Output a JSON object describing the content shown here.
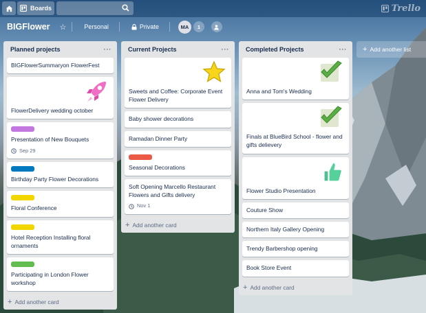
{
  "nav": {
    "boards_label": "Boards",
    "search_placeholder": "",
    "logo_text": "Trello"
  },
  "board": {
    "title": "BIGFlower",
    "visibility_team": "Personal",
    "visibility_privacy": "Private",
    "member_initials": "MA",
    "member_count": "1",
    "add_list_label": "Add another list"
  },
  "lists": [
    {
      "title": "Planned projects",
      "menu": "···",
      "add_card": "Add another card",
      "cards": [
        {
          "text": "BIGFlowerSummaryon FlowerFest"
        },
        {
          "text": "FlowerDelivery wedding october",
          "sticker": "rocket-sticker"
        },
        {
          "text": "Presentation of New Bouquets",
          "label_color": "#c377e0",
          "due": "Sep 29"
        },
        {
          "text": "Birthday Party Flower Decorations",
          "label_color": "#0079bf"
        },
        {
          "text": "Floral Conference",
          "label_color": "#f2d600"
        },
        {
          "text": "Hotel Reception Installing floral ornaments",
          "label_color": "#f2d600"
        },
        {
          "text": "Participating in London Flower workshop",
          "label_color": "#61bd4f"
        }
      ]
    },
    {
      "title": "Current Projects",
      "menu": "···",
      "add_card": "Add another card",
      "cards": [
        {
          "text": "Sweets and Coffee: Corporate Event Flower Delivery",
          "sticker": "star-sticker"
        },
        {
          "text": "Baby shower decorations"
        },
        {
          "text": "Ramadan Dinner Party"
        },
        {
          "text": "Seasonal Decorations",
          "label_color": "#eb5a46"
        },
        {
          "text": "Soft Opening Marcello Restaurant Flowers and Gifts delivery",
          "due": "Nov 1"
        }
      ]
    },
    {
      "title": "Completed Projects",
      "menu": "···",
      "add_card": "Add another card",
      "cards": [
        {
          "text": "Anna and Tom's Wedding",
          "sticker": "check-sticker"
        },
        {
          "text": "Finals at BlueBird School - flower and gifts delievery",
          "sticker": "check-sticker"
        },
        {
          "text": "Flower Studio Presentation",
          "sticker": "thumbs-up-sticker"
        },
        {
          "text": "Couture Show"
        },
        {
          "text": "Northern Italy Gallery Opening"
        },
        {
          "text": "Trendy Barbershop opening"
        },
        {
          "text": "Book Store Event"
        }
      ]
    }
  ]
}
